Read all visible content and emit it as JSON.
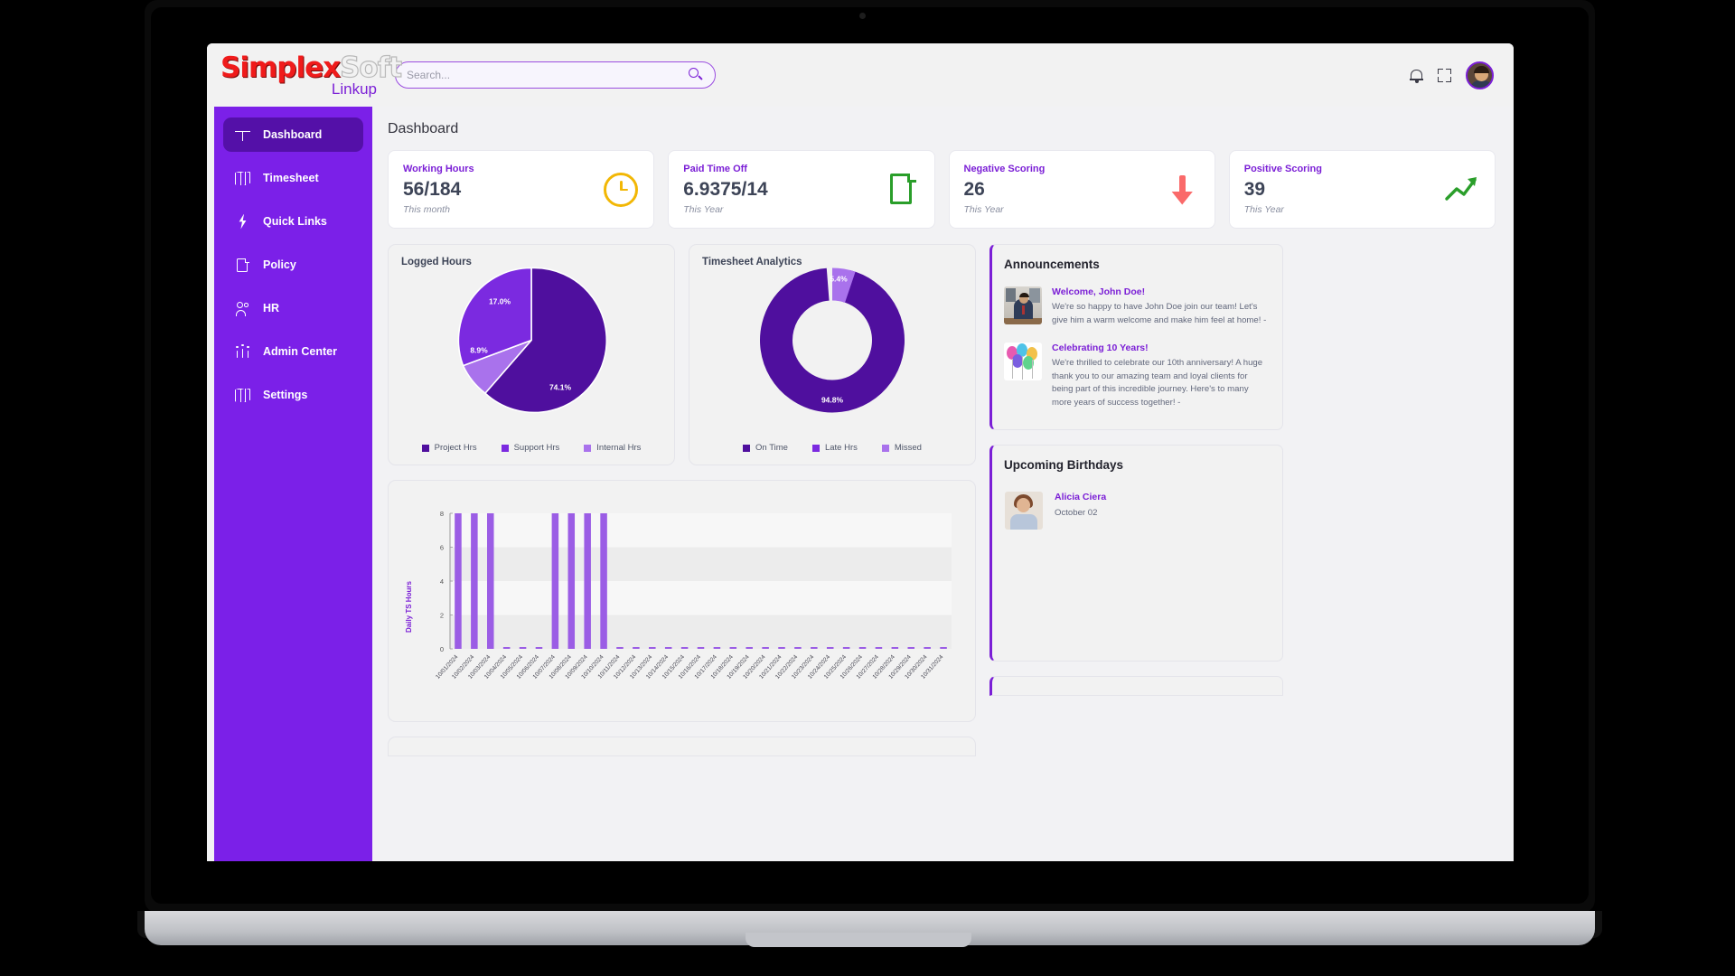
{
  "brand": {
    "logo_primary": "Simplex",
    "logo_secondary": "Soft",
    "logo_tagline": "Linkup"
  },
  "search": {
    "placeholder": "Search...",
    "value": "",
    "icon": "search-icon"
  },
  "topbar": {
    "notifications_icon": "bell-icon",
    "fullscreen_icon": "expand-icon",
    "avatar": "user-avatar"
  },
  "sidebar": {
    "items": [
      {
        "label": "Dashboard",
        "icon": "dashboard-icon",
        "active": true
      },
      {
        "label": "Timesheet",
        "icon": "map-icon",
        "active": false
      },
      {
        "label": "Quick Links",
        "icon": "lightning-icon",
        "active": false
      },
      {
        "label": "Policy",
        "icon": "document-icon",
        "active": false
      },
      {
        "label": "HR",
        "icon": "people-icon",
        "active": false
      },
      {
        "label": "Admin Center",
        "icon": "admin-icon",
        "active": false
      },
      {
        "label": "Settings",
        "icon": "settings-map-icon",
        "active": false
      }
    ]
  },
  "page": {
    "title": "Dashboard"
  },
  "kpis": [
    {
      "label": "Working Hours",
      "value": "56/184",
      "sub": "This month",
      "icon": "clock-icon",
      "color": "#f2b705"
    },
    {
      "label": "Paid Time Off",
      "value": "6.9375/14",
      "sub": "This Year",
      "icon": "file-icon",
      "color": "#2a9e2a"
    },
    {
      "label": "Negative Scoring",
      "value": "26",
      "sub": "This Year",
      "icon": "arrow-down-icon",
      "color": "#fa6a6a"
    },
    {
      "label": "Positive Scoring",
      "value": "39",
      "sub": "This Year",
      "icon": "trend-up-icon",
      "color": "#2a9e2a"
    }
  ],
  "chart_data": [
    {
      "type": "pie",
      "title": "Logged Hours",
      "categories": [
        "Project Hrs",
        "Support Hrs",
        "Internal Hrs"
      ],
      "values": [
        74.1,
        17.0,
        8.9
      ],
      "labels": [
        "74.1%",
        "17.0%",
        "8.9%"
      ],
      "colors": [
        "#4f0f9e",
        "#7b2ae0",
        "#a972ec"
      ],
      "legend_position": "bottom"
    },
    {
      "type": "pie",
      "title": "Timesheet Analytics",
      "categories": [
        "On Time",
        "Late Hrs",
        "Missed"
      ],
      "values": [
        94.8,
        5.4,
        0.0
      ],
      "labels": [
        "94.8%",
        "5.4%",
        ""
      ],
      "colors": [
        "#4f0f9e",
        "#7b2ae0",
        "#a972ec"
      ],
      "donut": true,
      "legend_position": "bottom"
    },
    {
      "type": "bar",
      "title": "",
      "ylabel": "Daily TS Hours",
      "xlabel": "",
      "ylim": [
        0,
        8
      ],
      "yticks": [
        0,
        2,
        4,
        6,
        8
      ],
      "bar_color": "#9b5de5",
      "categories": [
        "10/01/2024",
        "10/02/2024",
        "10/03/2024",
        "10/04/2024",
        "10/05/2024",
        "10/06/2024",
        "10/07/2024",
        "10/08/2024",
        "10/09/2024",
        "10/10/2024",
        "10/11/2024",
        "10/12/2024",
        "10/13/2024",
        "10/14/2024",
        "10/15/2024",
        "10/16/2024",
        "10/17/2024",
        "10/18/2024",
        "10/19/2024",
        "10/20/2024",
        "10/21/2024",
        "10/22/2024",
        "10/23/2024",
        "10/24/2024",
        "10/25/2024",
        "10/26/2024",
        "10/27/2024",
        "10/28/2024",
        "10/29/2024",
        "10/30/2024",
        "10/31/2024"
      ],
      "values": [
        8,
        8,
        8,
        0.1,
        0.1,
        0.1,
        8,
        8,
        8,
        8,
        0.1,
        0.1,
        0.1,
        0.1,
        0.1,
        0.1,
        0.1,
        0.1,
        0.1,
        0.1,
        0.1,
        0.1,
        0.1,
        0.1,
        0.1,
        0.1,
        0.1,
        0.1,
        0.1,
        0.1,
        0.1
      ]
    }
  ],
  "announcements": {
    "title": "Announcements",
    "items": [
      {
        "title": "Welcome, John Doe!",
        "body": "We're so happy to have John Doe join our team! Let's give him a warm welcome and make him feel at home! -",
        "thumb": "office-photo"
      },
      {
        "title": "Celebrating 10 Years!",
        "body": "We're thrilled to celebrate our 10th anniversary! A huge thank you to our amazing team and loyal clients for being part of this incredible journey. Here's to many more years of success together! -",
        "thumb": "balloons-photo"
      }
    ]
  },
  "birthdays": {
    "title": "Upcoming Birthdays",
    "items": [
      {
        "name": "Alicia Ciera",
        "date": "October 02",
        "thumb": "person-photo"
      }
    ]
  }
}
